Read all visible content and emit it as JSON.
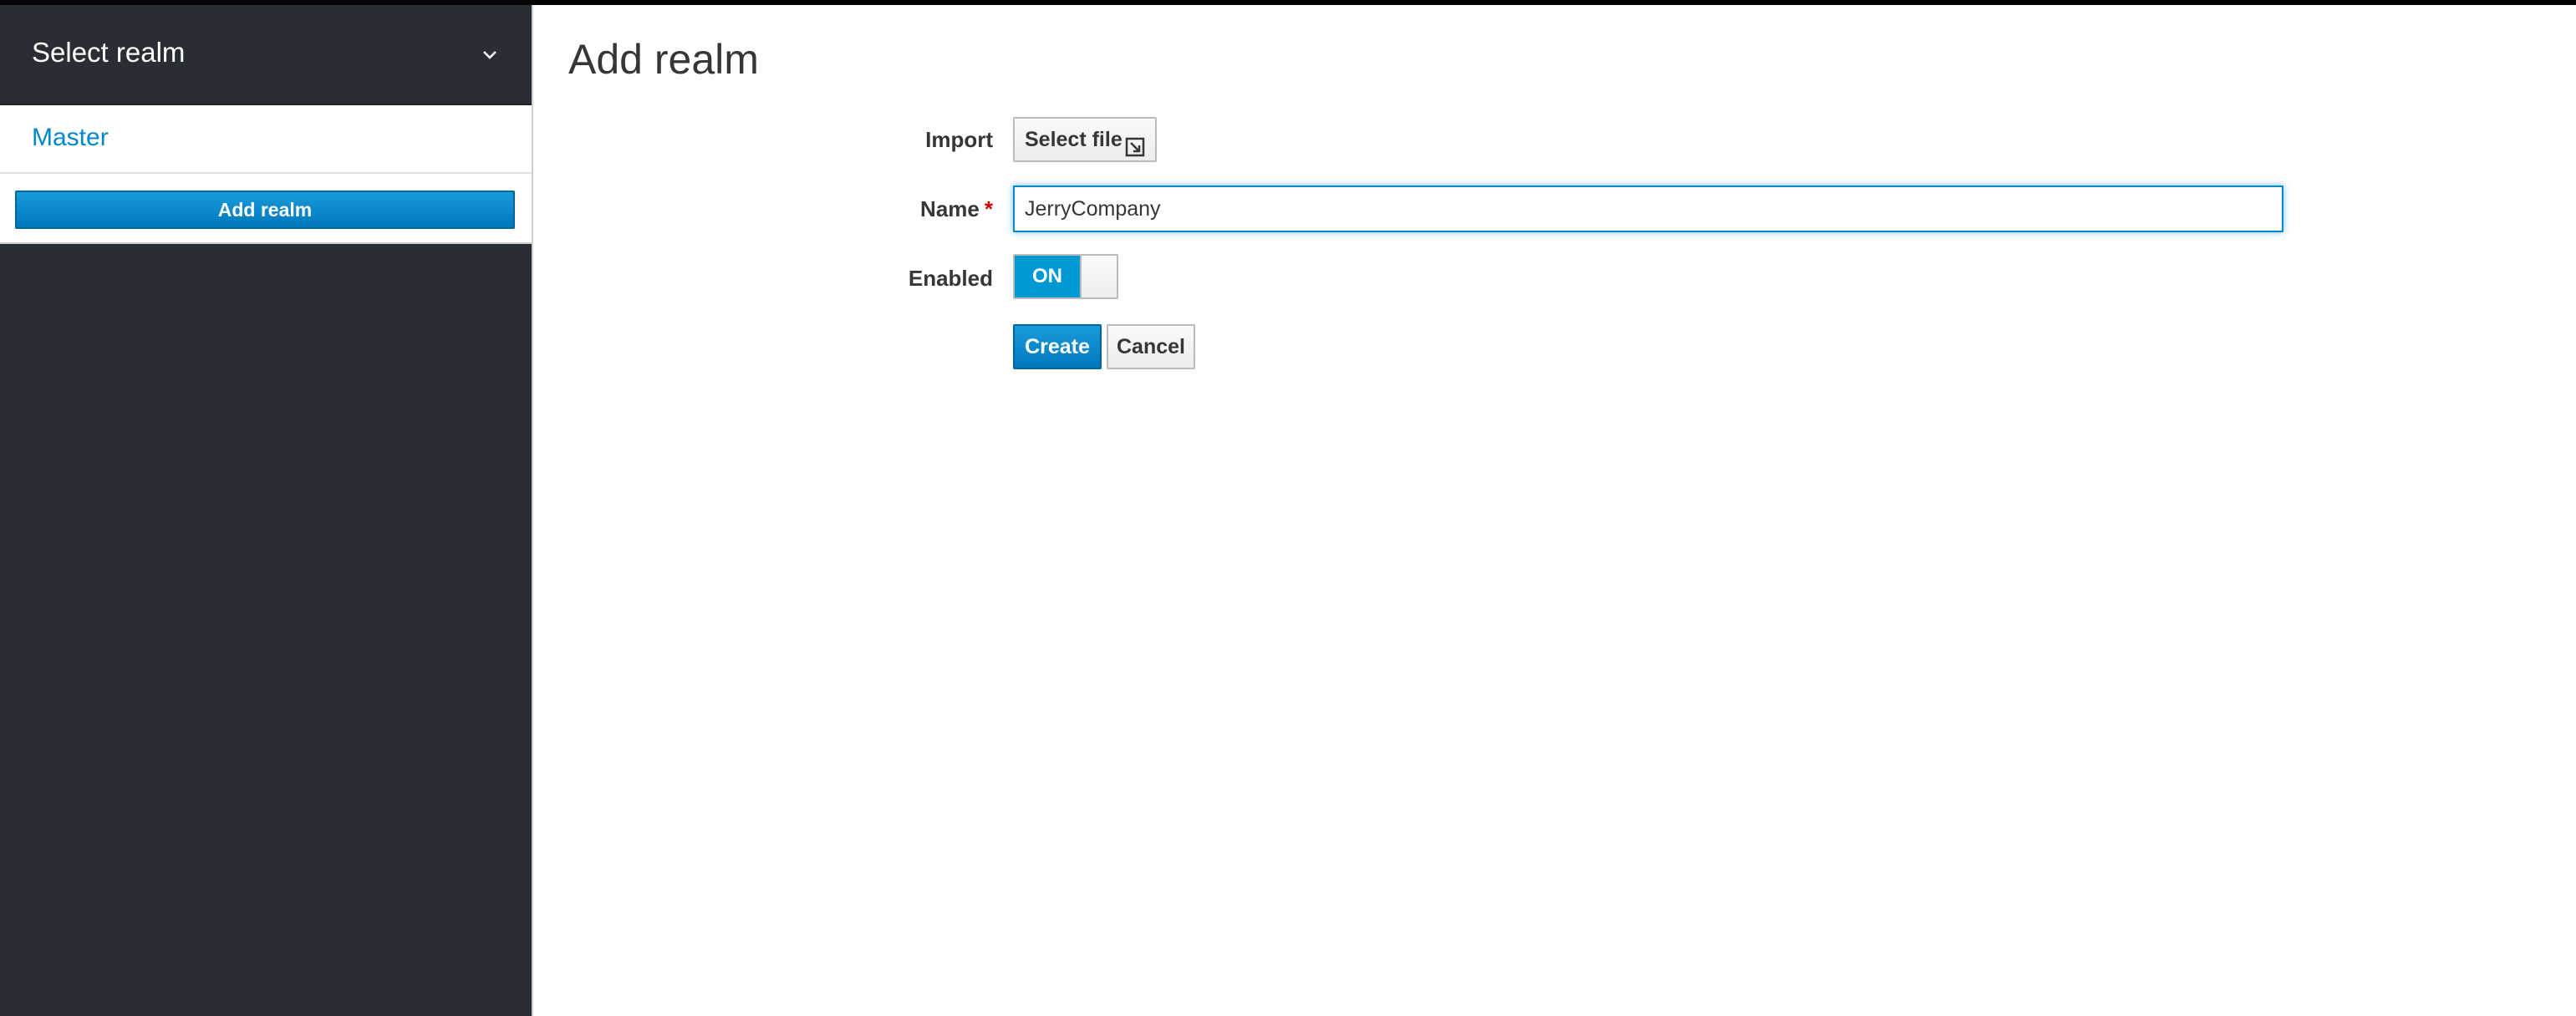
{
  "sidebar": {
    "realm_selector": {
      "label": "Select realm",
      "icon": "chevron-down-icon"
    },
    "realms": [
      {
        "label": "Master"
      }
    ],
    "add_realm_label": "Add realm"
  },
  "main": {
    "title": "Add realm",
    "form": {
      "import": {
        "label": "Import",
        "button_label": "Select file",
        "button_icon": "external-link-icon"
      },
      "name": {
        "label": "Name",
        "required_mark": "*",
        "value": "JerryCompany"
      },
      "enabled": {
        "label": "Enabled",
        "state_label": "ON"
      },
      "create_label": "Create",
      "cancel_label": "Cancel"
    }
  },
  "colors": {
    "sidebar_bg": "#292e34",
    "link": "#0088ce",
    "primary": "#0088ce",
    "required": "#cc0000"
  }
}
